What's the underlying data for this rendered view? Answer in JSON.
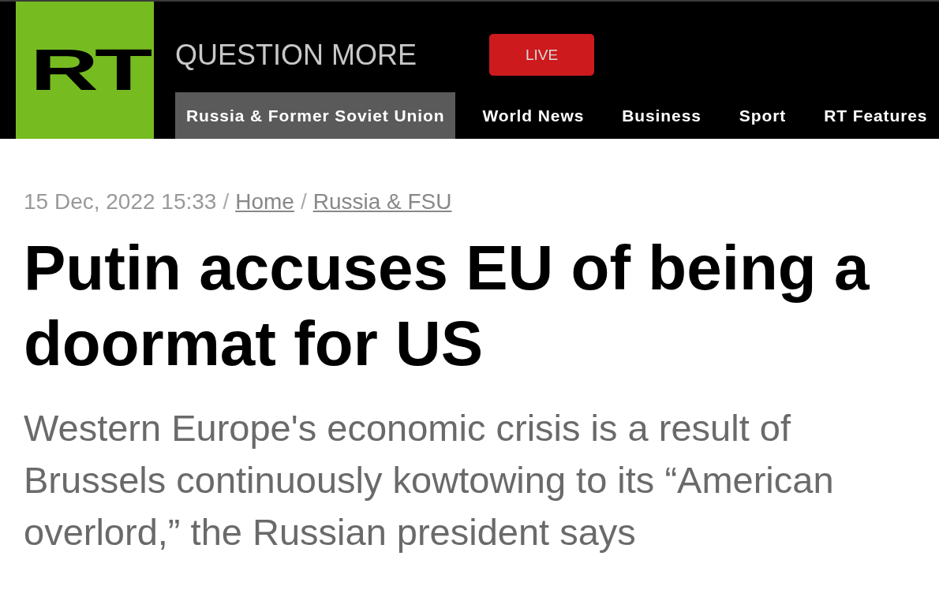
{
  "header": {
    "logo": "RT",
    "tagline": "QUESTION MORE",
    "live_button": "LIVE",
    "nav": [
      {
        "label": "Russia & Former Soviet Union",
        "selected": true
      },
      {
        "label": "World News",
        "selected": false
      },
      {
        "label": "Business",
        "selected": false
      },
      {
        "label": "Sport",
        "selected": false
      },
      {
        "label": "RT Features",
        "selected": false
      }
    ]
  },
  "article": {
    "breadcrumb": [
      {
        "kind": "date",
        "text": "15 Dec, 2022 15:33"
      },
      {
        "kind": "separator",
        "text": "/"
      },
      {
        "kind": "link",
        "text": "Home"
      },
      {
        "kind": "separator",
        "text": "/"
      },
      {
        "kind": "link",
        "text": "Russia & FSU"
      }
    ],
    "headline": "Putin accuses EU of being a doormat for US",
    "summary": "Western Europe's economic crisis is a result of Brussels continuously kowtowing to its “American overlord,” the Russian president says"
  }
}
